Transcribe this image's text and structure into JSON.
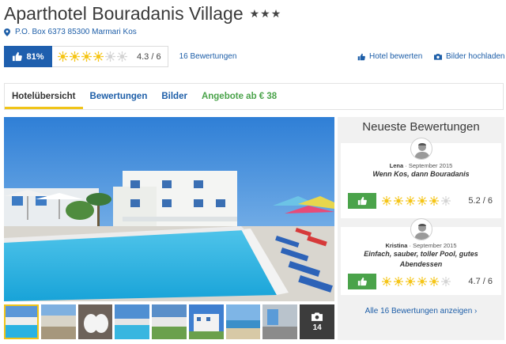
{
  "hotel": {
    "name": "Aparthotel Bouradanis Village",
    "stars": "★★★",
    "address": "P.O. Box 6373 85300 Marmari Kos"
  },
  "rating": {
    "recommendation": "81%",
    "suns_filled": 4,
    "suns_total": 6,
    "score": "4.3 / 6",
    "review_count": "16 Bewertungen"
  },
  "actions": {
    "rate_hotel": "Hotel bewerten",
    "upload_photos": "Bilder hochladen"
  },
  "tabs": [
    {
      "label": "Hotelübersicht",
      "active": true
    },
    {
      "label": "Bewertungen"
    },
    {
      "label": "Bilder"
    },
    {
      "label": "Angebote ab € 38"
    }
  ],
  "gallery": {
    "more_count": "14"
  },
  "reviews": {
    "heading": "Neueste Bewertungen",
    "items": [
      {
        "author": "Lena",
        "date": "September 2015",
        "title": "Wenn Kos, dann Bouradanis",
        "suns_filled": 5,
        "score": "5.2 / 6"
      },
      {
        "author": "Kristina",
        "date": "September 2015",
        "title": "Einfach, sauber, toller Pool, gutes Abendessen",
        "suns_filled": 5,
        "score": "4.7 / 6"
      }
    ],
    "all_link": "Alle 16 Bewertungen anzeigen ›"
  },
  "colors": {
    "brand_blue": "#1e5fae",
    "link_blue": "#1d5ea8",
    "green": "#4aa34a",
    "sun_yellow": "#f5c518",
    "tab_underline": "#f0c419"
  }
}
